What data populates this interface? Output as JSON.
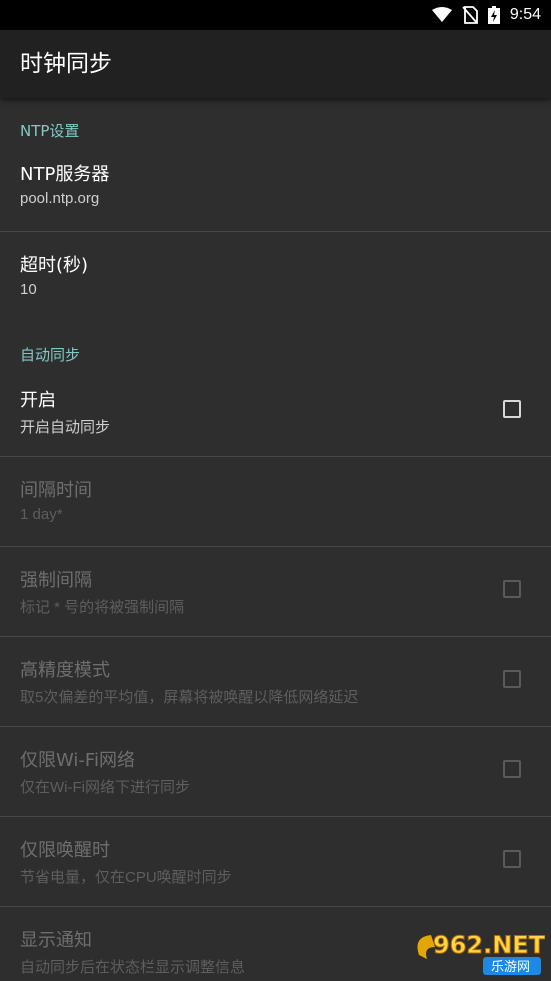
{
  "status_bar": {
    "time": "9:54"
  },
  "app_bar": {
    "title": "时钟同步"
  },
  "sections": {
    "ntp": {
      "label": "NTP设置"
    },
    "auto": {
      "label": "自动同步"
    }
  },
  "items": {
    "ntp_server": {
      "title": "NTP服务器",
      "summary": "pool.ntp.org"
    },
    "timeout": {
      "title": "超时(秒)",
      "summary": "10"
    },
    "enable": {
      "title": "开启",
      "summary": "开启自动同步",
      "checked": false
    },
    "interval": {
      "title": "间隔时间",
      "summary": "1 day*"
    },
    "force_interval": {
      "title": "强制间隔",
      "summary": "标记 * 号的将被强制间隔",
      "checked": false
    },
    "high_precision": {
      "title": "高精度模式",
      "summary": "取5次偏差的平均值，屏幕将被唤醒以降低网络延迟",
      "checked": false
    },
    "wifi_only": {
      "title": "仅限Wi-Fi网络",
      "summary": "仅在Wi-Fi网络下进行同步",
      "checked": false
    },
    "awake_only": {
      "title": "仅限唤醒时",
      "summary": "节省电量，仅在CPU唤醒时同步",
      "checked": false
    },
    "notify": {
      "title": "显示通知",
      "summary": "自动同步后在状态栏显示调整信息"
    }
  },
  "watermark": {
    "text": "962.NET",
    "subtext": "乐游网"
  }
}
